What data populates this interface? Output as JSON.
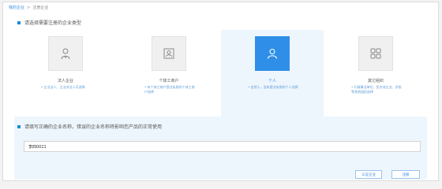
{
  "breadcrumb": {
    "home": "我的企业",
    "separator": ">",
    "current": "注册企业"
  },
  "section1": {
    "title": "请选择需要注册的企业类型"
  },
  "cards": [
    {
      "name": "法人企业",
      "desc": "企业法人、企业非法人可选择",
      "icon": "person-badge-icon",
      "selected": false
    },
    {
      "name": "个体工商户",
      "desc": "有个体工商户营业执照的个体工商户选择",
      "icon": "portrait-icon",
      "selected": false
    },
    {
      "name": "个人",
      "desc": "自然人，没有营业执照的个人选择",
      "icon": "user-icon",
      "selected": true
    },
    {
      "name": "其它组织",
      "desc": "行政事业单位、民办非企业、学校等其他组织选择",
      "icon": "grid-icon",
      "selected": false
    }
  ],
  "section2": {
    "title": "请填写正确的企业名称，错误的企业名称将影响您产品的正常使用"
  },
  "form": {
    "company_name_value": "李四0021"
  },
  "buttons": {
    "certify": "认证企业",
    "register": "注册"
  },
  "colors": {
    "accent": "#2f8fe8",
    "selected_bg": "#eef6fd"
  }
}
